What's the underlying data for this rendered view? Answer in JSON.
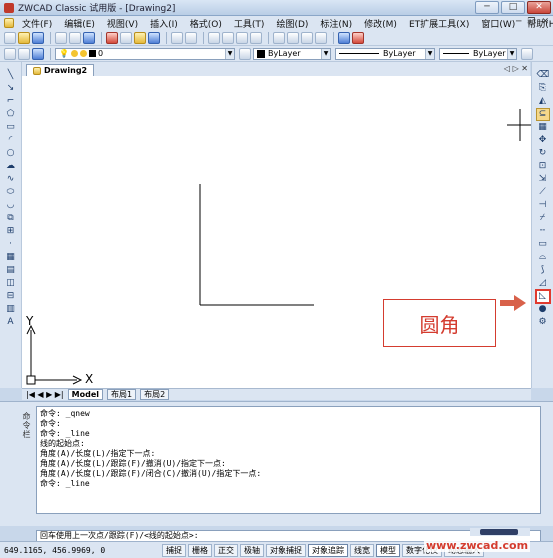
{
  "window": {
    "title": "ZWCAD Classic 试用版 - [Drawing2]",
    "buttons": {
      "minimize": "─",
      "restore": "□",
      "close": "✕"
    }
  },
  "menu": {
    "items": [
      "文件(F)",
      "编辑(E)",
      "视图(V)",
      "插入(I)",
      "格式(O)",
      "工具(T)",
      "绘图(D)",
      "标注(N)",
      "修改(M)",
      "ET扩展工具(X)",
      "窗口(W)",
      "帮助(H)"
    ],
    "mdi_controls": {
      "minimize": "─",
      "restore": "❐",
      "close": "✕"
    }
  },
  "properties_toolbar": {
    "layer_value": "0",
    "color_value": "ByLayer",
    "linetype_value": "ByLayer",
    "lineweight_value": "ByLayer"
  },
  "drawing_tab": {
    "label": "Drawing2",
    "nav": "◁ ▷ ✕"
  },
  "canvas": {
    "ucs_y": "Y",
    "ucs_x": "X"
  },
  "layout_tabs": {
    "nav": "|◀ ◀ ▶ ▶|",
    "tabs": [
      "Model",
      "布局1",
      "布局2"
    ],
    "active": "Model"
  },
  "command": {
    "side_label": "命令栏",
    "history": [
      "命令: _qnew",
      "命令:",
      "命令: _line",
      "线的起始点:",
      "角度(A)/长度(L)/指定下一点:",
      "角度(A)/长度(L)/跟踪(F)/撤消(U)/指定下一点:",
      "角度(A)/长度(L)/跟踪(F)/闭合(C)/撤消(U)/指定下一点:",
      "命令: _line"
    ],
    "prompt": "回车使用上一次点/跟踪(F)/<线的起始点>:"
  },
  "status": {
    "coords": "649.1165, 456.9969, 0",
    "toggles": [
      "捕捉",
      "栅格",
      "正交",
      "极轴",
      "对象捕捉",
      "对象追踪",
      "线宽",
      "模型",
      "数字化仪",
      "动态输入"
    ],
    "on": [
      "对象追踪",
      "模型"
    ]
  },
  "annotation": {
    "callout_text": "圆角",
    "watermark": "www.zwcad.com"
  },
  "colors": {
    "accent_red": "#d43c2f",
    "chrome": "#dbe5f2"
  },
  "icons": {
    "left_toolbar": [
      "line-icon",
      "ray-icon",
      "polyline-icon",
      "polygon-icon",
      "rectangle-icon",
      "arc-icon",
      "circle-icon",
      "cloud-icon",
      "spline-icon",
      "ellipse-icon",
      "ellipse-arc-icon",
      "insert-block-icon",
      "make-block-icon",
      "point-icon",
      "hatch-icon",
      "gradient-icon",
      "region-icon",
      "wipeout-icon",
      "table-icon",
      "mtext-icon"
    ],
    "right_toolbar": [
      "erase-icon",
      "copy-icon",
      "mirror-icon",
      "offset-icon",
      "array-icon",
      "move-icon",
      "rotate-icon",
      "scale-icon",
      "stretch-icon",
      "trim-icon",
      "extend-icon",
      "break-point-icon",
      "break-icon",
      "join-icon",
      "chamfer-icon",
      "fillet-icon",
      "explode-icon",
      "properties-icon"
    ]
  }
}
